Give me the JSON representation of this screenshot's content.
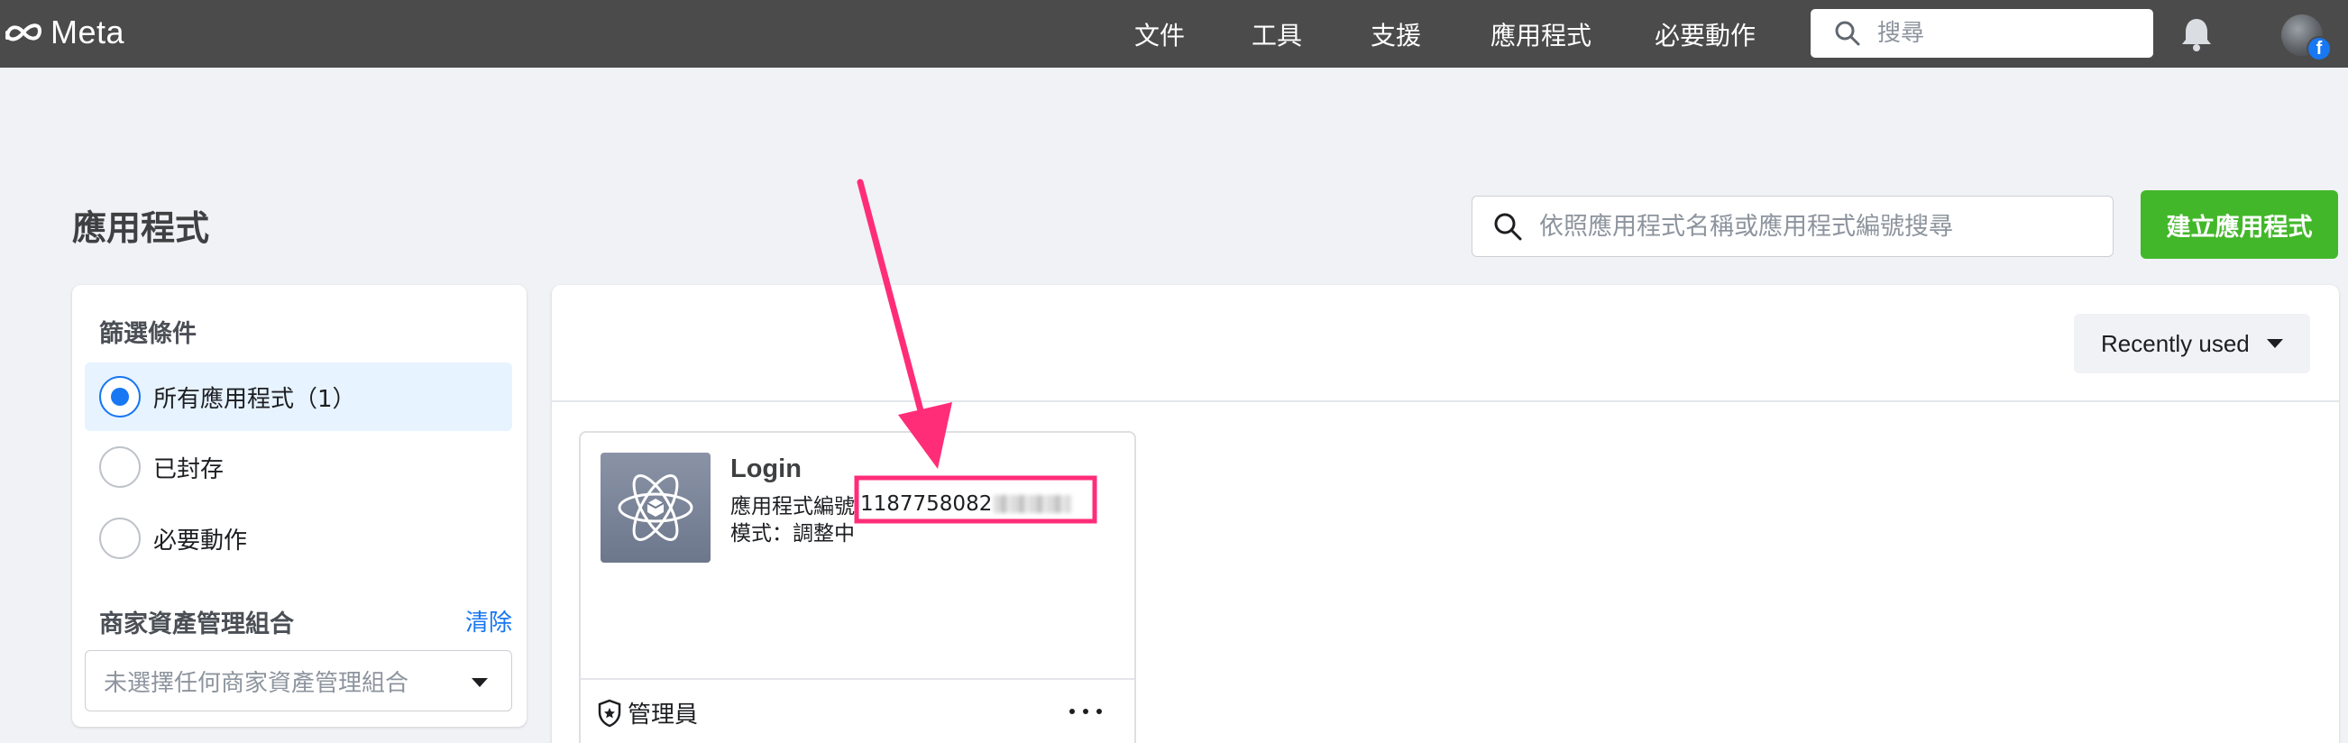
{
  "topnav": {
    "logo_text": "Meta",
    "links": [
      "文件",
      "工具",
      "支援",
      "應用程式",
      "必要動作"
    ],
    "search_placeholder": "搜尋",
    "avatar_badge": "f"
  },
  "page": {
    "title": "應用程式",
    "search_placeholder": "依照應用程式名稱或應用程式編號搜尋",
    "create_button": "建立應用程式"
  },
  "filters": {
    "title": "篩選條件",
    "options": [
      {
        "label": "所有應用程式（1）",
        "selected": true
      },
      {
        "label": "已封存",
        "selected": false
      },
      {
        "label": "必要動作",
        "selected": false
      }
    ],
    "business_title": "商家資產管理組合",
    "clear_label": "清除",
    "business_select_placeholder": "未選擇任何商家資產管理組合"
  },
  "apps": {
    "sort_label": "Recently used",
    "cards": [
      {
        "name": "Login",
        "id_label": "應用程式編號",
        "id_value": "1187758082",
        "mode_text": "模式：調整中",
        "role": "管理員"
      }
    ]
  },
  "colors": {
    "topbar": "#4b4b4b",
    "accent_blue": "#1877f2",
    "create_green": "#42b72a",
    "annotation_pink": "#ff2d78"
  },
  "icons": {
    "search": "search-icon",
    "bell": "bell-icon",
    "app": "atom-icon",
    "shield": "shield-icon",
    "more": "more-icon",
    "caret": "caret-down-icon"
  }
}
